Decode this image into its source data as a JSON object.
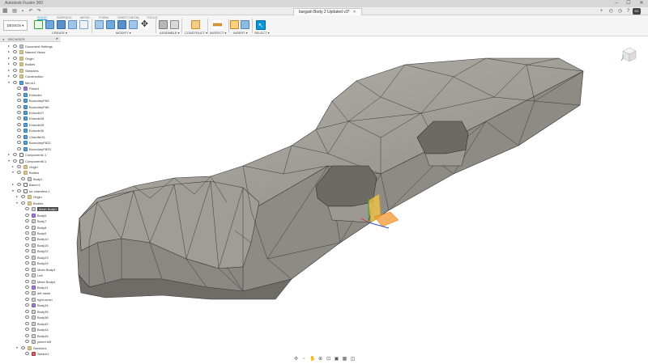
{
  "window": {
    "app_title": "Autodesk Fusion 360",
    "doc_tab_title": "bargain Body 2 Updated v3*",
    "minimize": "–",
    "maximize": "☐",
    "close": "✕",
    "avatar": "SC"
  },
  "toolbar": {
    "design_button": "DESIGN ▾",
    "workspace_tabs": [
      "SOLID",
      "SURFACE",
      "MESH",
      "FORM",
      "SHEET METAL",
      "TOOLS"
    ],
    "active_tab": "SOLID",
    "groups": [
      {
        "label": "CREATE ▾"
      },
      {
        "label": "MODIFY ▾"
      },
      {
        "label": "ASSEMBLE ▾"
      },
      {
        "label": "CONSTRUCT ▾"
      },
      {
        "label": "INSPECT ▾"
      },
      {
        "label": "INSERT ▾"
      },
      {
        "label": "SELECT ▾"
      }
    ]
  },
  "browser": {
    "title": "BROWSER",
    "items": [
      {
        "label": "Document Settings",
        "icon": "gear-icon"
      },
      {
        "label": "Named Views",
        "icon": "folder-icon"
      },
      {
        "label": "Origin",
        "icon": "folder-icon"
      },
      {
        "label": "Bodies",
        "icon": "folder-icon"
      },
      {
        "label": "Sketches",
        "icon": "folder-icon"
      },
      {
        "label": "Construction",
        "icon": "folder-icon"
      },
      {
        "label": "Mirror1",
        "icon": "mirror-icon"
      },
      {
        "label": "Plane1",
        "icon": "plane-icon"
      },
      {
        "label": "Extrude1",
        "icon": "extrude-icon"
      },
      {
        "label": "BoundaryFill5",
        "icon": "extrude-icon"
      },
      {
        "label": "BoundaryFill6",
        "icon": "extrude-icon"
      },
      {
        "label": "Extrude27",
        "icon": "extrude-icon"
      },
      {
        "label": "Extrude28",
        "icon": "extrude-icon"
      },
      {
        "label": "Extrude29",
        "icon": "extrude-icon"
      },
      {
        "label": "Extrude30",
        "icon": "extrude-icon"
      },
      {
        "label": "Chamfer31",
        "icon": "extrude-icon"
      },
      {
        "label": "BoundaryFill32",
        "icon": "extrude-icon"
      },
      {
        "label": "BoundaryFill33",
        "icon": "extrude-icon"
      },
      {
        "label": "Component1:1",
        "icon": "component-icon"
      },
      {
        "label": "Component5:1",
        "icon": "component-icon"
      },
      {
        "label": "Origin",
        "icon": "folder-icon"
      },
      {
        "label": "Bodies",
        "icon": "folder-icon"
      },
      {
        "label": "Body1",
        "icon": "body-icon"
      },
      {
        "label": "Barrel:1",
        "icon": "component-icon"
      },
      {
        "label": "for chamfers:1",
        "icon": "component-icon"
      },
      {
        "label": "Origin",
        "icon": "folder-icon"
      },
      {
        "label": "Bodies",
        "icon": "folder-icon"
      },
      {
        "label": "Mesh Body1",
        "icon": "body-icon",
        "selected": true
      },
      {
        "label": "Body5",
        "icon": "purple-body-icon"
      },
      {
        "label": "Body7",
        "icon": "body-icon"
      },
      {
        "label": "Body8",
        "icon": "body-icon"
      },
      {
        "label": "Body9",
        "icon": "body-icon"
      },
      {
        "label": "Body10",
        "icon": "body-icon"
      },
      {
        "label": "Body15",
        "icon": "body-icon"
      },
      {
        "label": "Body22",
        "icon": "body-icon"
      },
      {
        "label": "Body23",
        "icon": "body-icon"
      },
      {
        "label": "Body24",
        "icon": "body-icon"
      },
      {
        "label": "Mesh Body3",
        "icon": "body-icon"
      },
      {
        "label": "Left",
        "icon": "body-icon"
      },
      {
        "label": "Mesh Body4",
        "icon": "body-icon"
      },
      {
        "label": "Body11",
        "icon": "purple-body-icon"
      },
      {
        "label": "left mesh",
        "icon": "body-icon"
      },
      {
        "label": "right mesh",
        "icon": "body-icon"
      },
      {
        "label": "Body34",
        "icon": "purple-body-icon"
      },
      {
        "label": "Body35",
        "icon": "body-icon"
      },
      {
        "label": "Body36",
        "icon": "body-icon"
      },
      {
        "label": "Body42",
        "icon": "body-icon"
      },
      {
        "label": "Body44",
        "icon": "body-icon"
      },
      {
        "label": "Body45",
        "icon": "body-icon"
      },
      {
        "label": "joined left",
        "icon": "body-icon"
      },
      {
        "label": "Sketches",
        "icon": "folder-icon"
      },
      {
        "label": "Sketch1",
        "icon": "sketch-icon"
      }
    ]
  },
  "colors": {
    "accent": "#0696d7",
    "model_face": "#8e8b84",
    "model_top": "#a9a69f"
  }
}
